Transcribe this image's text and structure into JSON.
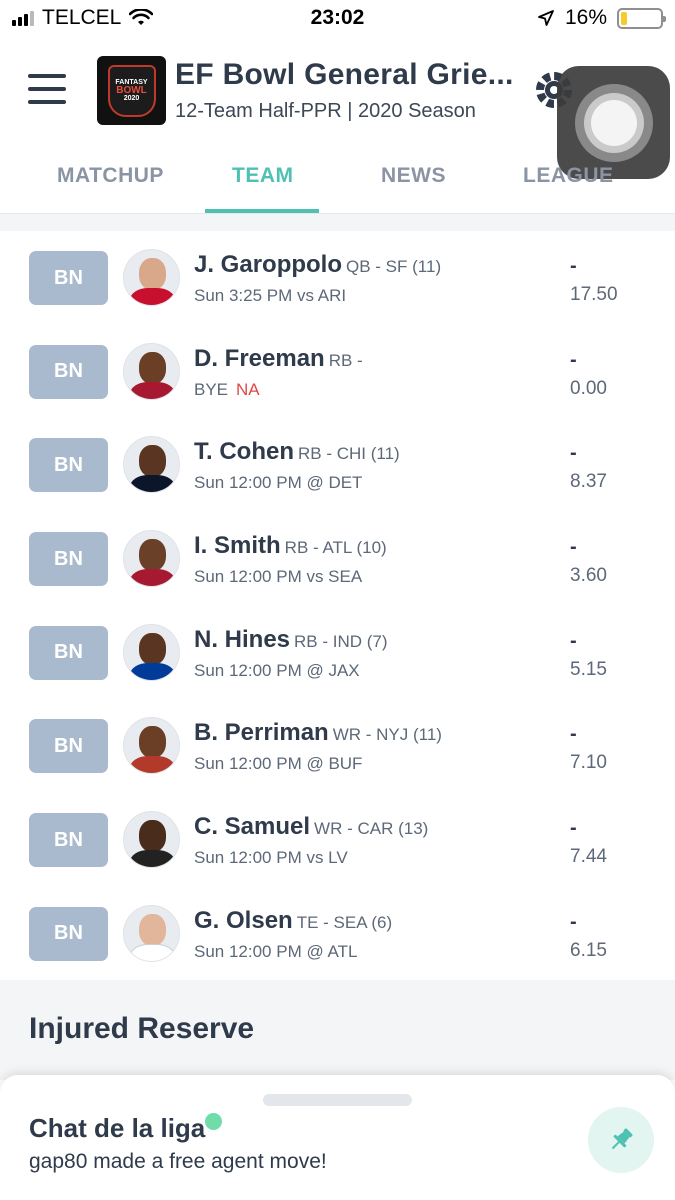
{
  "status_bar": {
    "carrier": "TELCEL",
    "time": "23:02",
    "battery": "16%",
    "battery_level": 0.16,
    "battery_color": "#f5cc2b"
  },
  "header": {
    "league_name": "EF Bowl General Grie...",
    "league_subtitle": "12-Team Half-PPR | 2020 Season",
    "logo_text_top": "FANTASY",
    "logo_text_main": "BOWL",
    "logo_text_year": "2020"
  },
  "tabs": [
    {
      "label": "MATCHUP"
    },
    {
      "label": "TEAM"
    },
    {
      "label": "NEWS"
    },
    {
      "label": "LEAGUE"
    }
  ],
  "active_tab": "TEAM",
  "accent_color": "#4fc1b2",
  "players": [
    {
      "slot": "BN",
      "name": "J. Garoppolo",
      "pos_team": "QB - SF (11)",
      "game": "Sun 3:25 PM vs ARI",
      "status": "",
      "proj_dash": "-",
      "points": "17.50",
      "jersey": "#c8102e",
      "skin": "#d9a88a"
    },
    {
      "slot": "BN",
      "name": "D. Freeman",
      "pos_team": "RB -",
      "game": "BYE",
      "status": "NA",
      "proj_dash": "-",
      "points": "0.00",
      "jersey": "#a71930",
      "skin": "#6b3e26"
    },
    {
      "slot": "BN",
      "name": "T. Cohen",
      "pos_team": "RB - CHI (11)",
      "game": "Sun 12:00 PM @ DET",
      "status": "",
      "proj_dash": "-",
      "points": "8.37",
      "jersey": "#0b162a",
      "skin": "#5a3522"
    },
    {
      "slot": "BN",
      "name": "I. Smith",
      "pos_team": "RB - ATL (10)",
      "game": "Sun 12:00 PM vs SEA",
      "status": "",
      "proj_dash": "-",
      "points": "3.60",
      "jersey": "#a71930",
      "skin": "#6b4028"
    },
    {
      "slot": "BN",
      "name": "N. Hines",
      "pos_team": "RB - IND (7)",
      "game": "Sun 12:00 PM @ JAX",
      "status": "",
      "proj_dash": "-",
      "points": "5.15",
      "jersey": "#003b99",
      "skin": "#5a3522"
    },
    {
      "slot": "BN",
      "name": "B. Perriman",
      "pos_team": "WR - NYJ (11)",
      "game": "Sun 12:00 PM @ BUF",
      "status": "",
      "proj_dash": "-",
      "points": "7.10",
      "jersey": "#b33a2a",
      "skin": "#6b3e26"
    },
    {
      "slot": "BN",
      "name": "C. Samuel",
      "pos_team": "WR - CAR (13)",
      "game": "Sun 12:00 PM vs LV",
      "status": "",
      "proj_dash": "-",
      "points": "7.44",
      "jersey": "#222222",
      "skin": "#4a2c1c"
    },
    {
      "slot": "BN",
      "name": "G. Olsen",
      "pos_team": "TE - SEA (6)",
      "game": "Sun 12:00 PM @ ATL",
      "status": "",
      "proj_dash": "-",
      "points": "6.15",
      "jersey": "#ffffff",
      "skin": "#e2b69a"
    }
  ],
  "injured_reserve": {
    "title": "Injured Reserve"
  },
  "chat": {
    "title": "Chat de la liga",
    "message": "gap80 made a free agent move!"
  }
}
